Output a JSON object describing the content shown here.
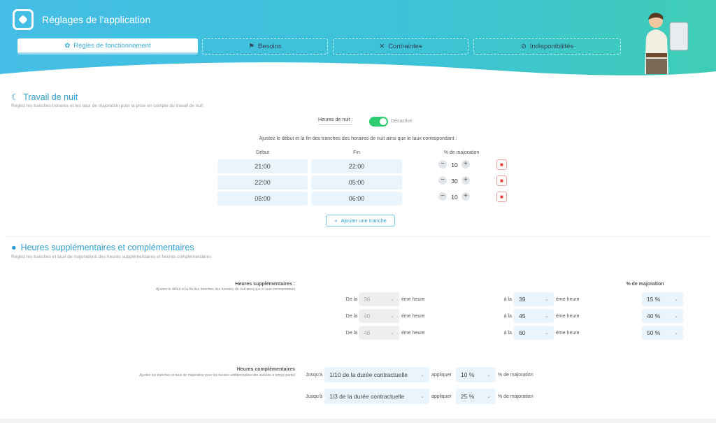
{
  "header": {
    "title": "Réglages de l'application",
    "tabs": [
      {
        "label": "Régles de fonctionnement",
        "icon": "gear-icon"
      },
      {
        "label": "Besoins",
        "icon": "flag-icon"
      },
      {
        "label": "Contraintes",
        "icon": "tools-icon"
      },
      {
        "label": "Indisponibilités",
        "icon": "ban-icon"
      }
    ]
  },
  "night": {
    "title": "Travail de nuit",
    "subtitle": "Réglez les tranches horaires et les taux de majoration pour la prise en compte du travail de nuit",
    "toggle_label": "Heures de nuit :",
    "toggle_state": "Désactivé",
    "instruction": "Ajustez le début et la fin des tranches des horaires de nuit ainsi que le taux correspondant :",
    "col_start": "Début",
    "col_end": "Fin",
    "col_rate": "% de majoration",
    "rows": [
      {
        "start": "21:00",
        "end": "22:00",
        "rate": "10"
      },
      {
        "start": "22:00",
        "end": "05:00",
        "rate": "30"
      },
      {
        "start": "05:00",
        "end": "06:00",
        "rate": "10"
      }
    ],
    "add_label": "Ajouter une tranche"
  },
  "overtime": {
    "title": "Heures supplémentaires et complémentaires",
    "subtitle": "Réglez les tranches et taux de majorations des heures supplémentaires et heures complémentaires",
    "sup_label": "Heures supplémentaires :",
    "sup_sub": "Ajustez le début et la fin des tranches des horaires de nuit ainsi que le taux correspondant",
    "rate_header": "% de majoration",
    "from": "De la",
    "to": "à la",
    "suffix": "éme heure",
    "rows": [
      {
        "from": "36",
        "to": "39",
        "rate": "15 %"
      },
      {
        "from": "40",
        "to": "45",
        "rate": "40 %"
      },
      {
        "from": "46",
        "to": "60",
        "rate": "50 %"
      }
    ],
    "comp_label": "Heures complémentaires",
    "comp_sub": "Ajustez les tranches et taux de majoration pour les heures additionnelles des salariés à temps partiel",
    "until": "Jusqu'à",
    "apply": "appliquer",
    "rate_suffix": "% de majoration",
    "comp_rows": [
      {
        "limit": "1/10 de la durée contractuelle",
        "rate": "10 %"
      },
      {
        "limit": "1/3 de la durée contractuelle",
        "rate": "25 %"
      }
    ]
  },
  "colors": {
    "accent": "#2f9fd2",
    "toggle": "#2ecc71",
    "danger": "#e53935"
  }
}
